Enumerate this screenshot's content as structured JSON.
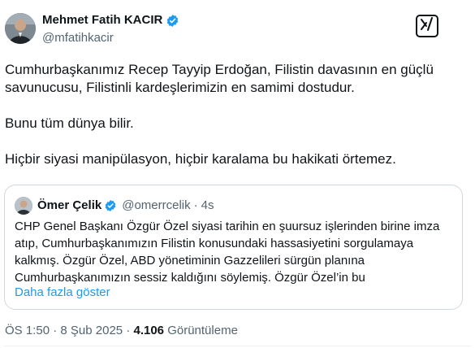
{
  "author": {
    "display_name": "Mehmet Fatih KACIR",
    "handle": "@mfatihkacir",
    "verified": true
  },
  "icons": {
    "verified": "verified-badge-icon",
    "grok": "grok-icon"
  },
  "tweet": {
    "paragraphs": [
      "Cumhurbaşkanımız Recep Tayyip Erdoğan, Filistin davasının en güçlü savunucusu, Filistinli kardeşlerimizin en samimi dostudur.",
      "Bunu tüm dünya bilir.",
      "Hiçbir siyasi manipülasyon, hiçbir karalama bu hakikati örtemez."
    ]
  },
  "quote": {
    "display_name": "Ömer Çelik",
    "handle": "@omerrcelik",
    "separator": "·",
    "time": "4s",
    "text": "CHP Genel Başkanı Özgür Özel siyasi tarihin en şuursuz işlerinden birine imza atıp, Cumhurbaşkanımızın Filistin konusundaki hassasiyetini sorgulamaya kalkmış. Özgür Özel, ABD yönetiminin Gazzelileri sürgün planına Cumhurbaşkanımızın sessiz kaldığını söylemiş. Özgür Özel’in bu",
    "show_more": "Daha fazla göster"
  },
  "meta": {
    "time": "ÖS 1:50",
    "separator": "·",
    "date": "8 Şub 2025",
    "views_count": "4.106",
    "views_label": "Görüntüleme"
  },
  "colors": {
    "text": "#0f1419",
    "secondary": "#536471",
    "link": "#1d9bf0",
    "verified": "#1d9bf0",
    "border": "#cfd9de"
  }
}
